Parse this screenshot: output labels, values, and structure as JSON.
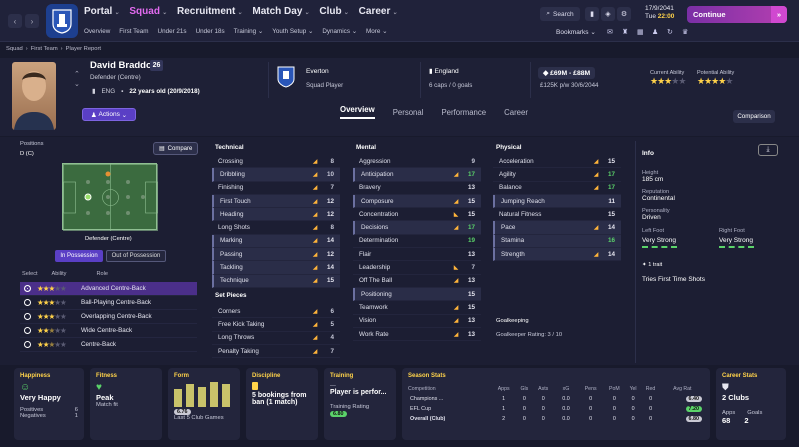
{
  "topbar": {
    "menu": [
      {
        "label": "Portal",
        "selected": false
      },
      {
        "label": "Squad",
        "selected": true
      },
      {
        "label": "Recruitment",
        "selected": false
      },
      {
        "label": "Match Day",
        "selected": false
      },
      {
        "label": "Club",
        "selected": false
      },
      {
        "label": "Career",
        "selected": false
      }
    ],
    "submenu": [
      "Overview",
      "First Team",
      "Under 21s",
      "Under 18s",
      "Training",
      "Youth Setup",
      "Dynamics",
      "More"
    ],
    "search_label": "Search",
    "date_line": "17/9/2041",
    "day": "Tue",
    "time": "22:00",
    "continue_label": "Continue",
    "bookmarks_label": "Bookmarks"
  },
  "breadcrumb": [
    "Squad",
    "First Team",
    "Player Report"
  ],
  "player": {
    "name": "David Braddock",
    "number": "26",
    "position": "Defender (Centre)",
    "nation_code": "ENG",
    "age_text": "22 years old (20/9/2018)",
    "club": "Everton",
    "squad_status": "Squad Player",
    "nation": "England",
    "caps": "6 caps / 0 goals",
    "value": "£69M - £88M",
    "wage": "£125K p/w 30/6/2044",
    "current_ability_label": "Current Ability",
    "current_ability_stars": 3,
    "potential_ability_label": "Potential Ability",
    "potential_ability_stars": 4,
    "actions_label": "Actions"
  },
  "tabs": [
    "Overview",
    "Personal",
    "Performance",
    "Career"
  ],
  "comparison_label": "Comparison",
  "positions": {
    "label": "Positions",
    "value": "D (C)",
    "compare_label": "Compare",
    "pitch_label": "Defender (Centre)",
    "in_possession": "In Possession",
    "out_possession": "Out of Possession",
    "cols": [
      "Select",
      "Ability",
      "Role"
    ]
  },
  "roles": [
    {
      "name": "Advanced Centre-Back",
      "stars": 3,
      "selected": true
    },
    {
      "name": "Ball-Playing Centre-Back",
      "stars": 3,
      "selected": false
    },
    {
      "name": "Overlapping Centre-Back",
      "stars": 3,
      "selected": false
    },
    {
      "name": "Wide Centre-Back",
      "stars": 2.5,
      "selected": false
    },
    {
      "name": "Centre-Back",
      "stars": 2.5,
      "selected": false
    }
  ],
  "attributes": {
    "technical": {
      "title": "Technical",
      "rows": [
        {
          "name": "Crossing",
          "value": "8",
          "trend": "up",
          "hl": false
        },
        {
          "name": "Dribbling",
          "value": "10",
          "trend": "up",
          "hl": true
        },
        {
          "name": "Finishing",
          "value": "7",
          "trend": "up",
          "hl": false
        },
        {
          "name": "First Touch",
          "value": "12",
          "trend": "up",
          "hl": true
        },
        {
          "name": "Heading",
          "value": "12",
          "trend": "up",
          "hl": true
        },
        {
          "name": "Long Shots",
          "value": "8",
          "trend": "up",
          "hl": false
        },
        {
          "name": "Marking",
          "value": "14",
          "trend": "up",
          "hl": true
        },
        {
          "name": "Passing",
          "value": "12",
          "trend": "up",
          "hl": true
        },
        {
          "name": "Tackling",
          "value": "14",
          "trend": "up",
          "hl": true
        },
        {
          "name": "Technique",
          "value": "15",
          "trend": "up",
          "hl": true
        }
      ]
    },
    "setpieces": {
      "title": "Set Pieces",
      "rows": [
        {
          "name": "Corners",
          "value": "6",
          "trend": "up",
          "hl": false
        },
        {
          "name": "Free Kick Taking",
          "value": "5",
          "trend": "up",
          "hl": false
        },
        {
          "name": "Long Throws",
          "value": "4",
          "trend": "up",
          "hl": false
        },
        {
          "name": "Penalty Taking",
          "value": "7",
          "trend": "up",
          "hl": false
        }
      ]
    },
    "mental": {
      "title": "Mental",
      "rows": [
        {
          "name": "Aggression",
          "value": "9",
          "trend": "",
          "hl": false
        },
        {
          "name": "Anticipation",
          "value": "17",
          "trend": "up",
          "hl": true
        },
        {
          "name": "Bravery",
          "value": "13",
          "trend": "",
          "hl": false
        },
        {
          "name": "Composure",
          "value": "15",
          "trend": "up",
          "hl": true
        },
        {
          "name": "Concentration",
          "value": "15",
          "trend": "dn",
          "hl": false
        },
        {
          "name": "Decisions",
          "value": "17",
          "trend": "up",
          "hl": true
        },
        {
          "name": "Determination",
          "value": "19",
          "trend": "",
          "hl": false
        },
        {
          "name": "Flair",
          "value": "13",
          "trend": "",
          "hl": false
        },
        {
          "name": "Leadership",
          "value": "7",
          "trend": "dn",
          "hl": false
        },
        {
          "name": "Off The Ball",
          "value": "13",
          "trend": "up",
          "hl": false
        },
        {
          "name": "Positioning",
          "value": "15",
          "trend": "",
          "hl": true
        },
        {
          "name": "Teamwork",
          "value": "15",
          "trend": "up",
          "hl": false
        },
        {
          "name": "Vision",
          "value": "13",
          "trend": "up",
          "hl": false
        },
        {
          "name": "Work Rate",
          "value": "13",
          "trend": "up",
          "hl": false
        }
      ]
    },
    "physical": {
      "title": "Physical",
      "rows": [
        {
          "name": "Acceleration",
          "value": "15",
          "trend": "up",
          "hl": false
        },
        {
          "name": "Agility",
          "value": "17",
          "trend": "up",
          "hl": false
        },
        {
          "name": "Balance",
          "value": "17",
          "trend": "up",
          "hl": false
        },
        {
          "name": "Jumping Reach",
          "value": "11",
          "trend": "",
          "hl": true
        },
        {
          "name": "Natural Fitness",
          "value": "15",
          "trend": "",
          "hl": false
        },
        {
          "name": "Pace",
          "value": "14",
          "trend": "up",
          "hl": true
        },
        {
          "name": "Stamina",
          "value": "16",
          "trend": "",
          "hl": true
        },
        {
          "name": "Strength",
          "value": "14",
          "trend": "up",
          "hl": true
        }
      ]
    },
    "goalkeeping": {
      "title": "Goalkeeping",
      "rating": "Goalkeeper Rating: 3 / 10"
    }
  },
  "info": {
    "title": "Info",
    "height_label": "Height",
    "height": "185 cm",
    "reputation_label": "Reputation",
    "reputation": "Continental",
    "personality_label": "Personality",
    "personality": "Driven",
    "left_foot_label": "Left Foot",
    "left_foot": "Very Strong",
    "right_foot_label": "Right Foot",
    "right_foot": "Very Strong",
    "traits_count": "1 trait",
    "trait": "Tries First Time Shots"
  },
  "cards": {
    "happiness": {
      "title": "Happiness",
      "value": "Very Happy",
      "pos_label": "Positives",
      "pos": "6",
      "neg_label": "Negatives",
      "neg": "1"
    },
    "fitness": {
      "title": "Fitness",
      "value": "Peak",
      "sub": "Match fit"
    },
    "form": {
      "title": "Form",
      "rating": "6.76",
      "sub": "Last 5 Club Games",
      "bars": [
        6.6,
        6.8,
        6.7,
        6.9,
        6.8
      ]
    },
    "discipline": {
      "title": "Discipline",
      "value": "5 bookings from ban (1 match)"
    },
    "training": {
      "title": "Training",
      "value": "Player is perfor...",
      "rating_label": "Training Rating",
      "rating": "6.80"
    },
    "season": {
      "title": "Season Stats",
      "cols": [
        "Competition",
        "Apps",
        "Gls",
        "Asts",
        "xG",
        "Pens",
        "PoM",
        "Yel",
        "Red",
        "Avg Rat"
      ],
      "rows": [
        [
          "Champions ...",
          "1",
          "0",
          "0",
          "0.0",
          "0",
          "0",
          "0",
          "0",
          "6.40"
        ],
        [
          "EFL Cup",
          "1",
          "0",
          "0",
          "0.0",
          "0",
          "0",
          "0",
          "0",
          "7.20"
        ],
        [
          "Overall (Club)",
          "2",
          "0",
          "0",
          "0.0",
          "0",
          "0",
          "0",
          "0",
          "6.80"
        ]
      ]
    },
    "career": {
      "title": "Career Stats",
      "clubs": "2 Clubs",
      "apps_label": "Apps",
      "apps": "68",
      "goals_label": "Goals",
      "goals": "2"
    }
  },
  "colors": {
    "accent": "#b43fb0",
    "gold": "#ffd34a",
    "green": "#5bd36a"
  }
}
